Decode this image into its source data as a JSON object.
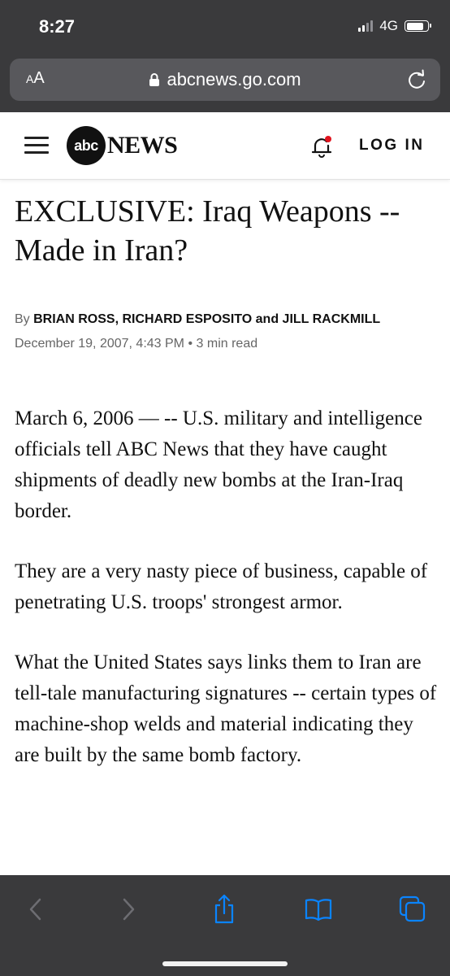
{
  "status_bar": {
    "time": "8:27",
    "network": "4G",
    "battery_level": 0.85,
    "signal_bars_active": 2
  },
  "browser": {
    "text_size_label": "AA",
    "url": "abcnews.go.com"
  },
  "site_header": {
    "logo_circle_text": "abc",
    "logo_text": "NEWS",
    "login_label": "LOG IN"
  },
  "article": {
    "headline": "EXCLUSIVE: Iraq Weapons -- Made in Iran?",
    "byline_prefix": "By",
    "author1": "BRIAN ROSS",
    "sep1": ", ",
    "author2": "RICHARD ESPOSITO",
    "sep2": " and ",
    "author3": "JILL RACKMILL",
    "date": "December 19, 2007, 4:43 PM",
    "read_time": "3 min read",
    "paragraphs": [
      "March 6, 2006 — -- U.S. military and intelligence officials tell ABC News that they have caught shipments of deadly new bombs at the Iran-Iraq border.",
      "They are a very nasty piece of business, capable of penetrating U.S. troops' strongest armor.",
      "What the United States says links them to Iran are tell-tale manufacturing signatures -- certain types of machine-shop welds and material indicating they are built by the same bomb factory."
    ]
  },
  "toolbar": {
    "icons": [
      "back-icon",
      "forward-icon",
      "share-icon",
      "bookmarks-icon",
      "tabs-icon"
    ],
    "accent": "#0a84ff"
  }
}
